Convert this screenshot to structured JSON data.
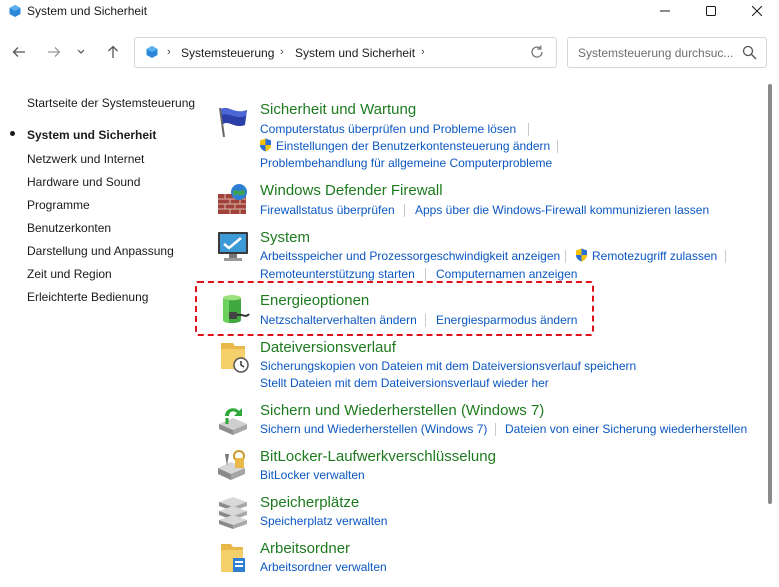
{
  "window": {
    "title": "System und Sicherheit"
  },
  "address": {
    "crumbs": [
      "Systemsteuerung",
      "System und Sicherheit"
    ],
    "search_placeholder": "Systemsteuerung durchsuc..."
  },
  "sidebar": {
    "items": [
      {
        "label": "Startseite der Systemsteuerung",
        "active": false
      },
      {
        "label": "System und Sicherheit",
        "active": true
      },
      {
        "label": "Netzwerk und Internet",
        "active": false
      },
      {
        "label": "Hardware und Sound",
        "active": false
      },
      {
        "label": "Programme",
        "active": false
      },
      {
        "label": "Benutzerkonten",
        "active": false
      },
      {
        "label": "Darstellung und Anpassung",
        "active": false
      },
      {
        "label": "Zeit und Region",
        "active": false
      },
      {
        "label": "Erleichterte Bedienung",
        "active": false
      }
    ]
  },
  "categories": {
    "security": {
      "title": "Sicherheit und Wartung",
      "links": [
        "Computerstatus überprüfen und Probleme lösen",
        "Einstellungen der Benutzerkontensteuerung ändern",
        "Problembehandlung für allgemeine Computerprobleme"
      ]
    },
    "firewall": {
      "title": "Windows Defender Firewall",
      "links": [
        "Firewallstatus überprüfen",
        "Apps über die Windows-Firewall kommunizieren lassen"
      ]
    },
    "system": {
      "title": "System",
      "links": [
        "Arbeitsspeicher und Prozessorgeschwindigkeit anzeigen",
        "Remotezugriff zulassen",
        "Remoteunterstützung starten",
        "Computernamen anzeigen"
      ]
    },
    "power": {
      "title": "Energieoptionen",
      "links": [
        "Netzschalterverhalten ändern",
        "Energiesparmodus ändern"
      ]
    },
    "filehistory": {
      "title": "Dateiversionsverlauf",
      "links": [
        "Sicherungskopien von Dateien mit dem Dateiversionsverlauf speichern",
        "Stellt Dateien mit dem Dateiversionsverlauf wieder her"
      ]
    },
    "backup": {
      "title": "Sichern und Wiederherstellen (Windows 7)",
      "links": [
        "Sichern und Wiederherstellen (Windows 7)",
        "Dateien von einer Sicherung wiederherstellen"
      ]
    },
    "bitlocker": {
      "title": "BitLocker-Laufwerkverschlüsselung",
      "links": [
        "BitLocker verwalten"
      ]
    },
    "storage": {
      "title": "Speicherplätze",
      "links": [
        "Speicherplatz verwalten"
      ]
    },
    "workfolders": {
      "title": "Arbeitsordner",
      "links": [
        "Arbeitsordner verwalten"
      ]
    }
  },
  "colors": {
    "category_title": "#1e7a1e",
    "link": "#0b57c2",
    "highlight": "#e0101a"
  }
}
